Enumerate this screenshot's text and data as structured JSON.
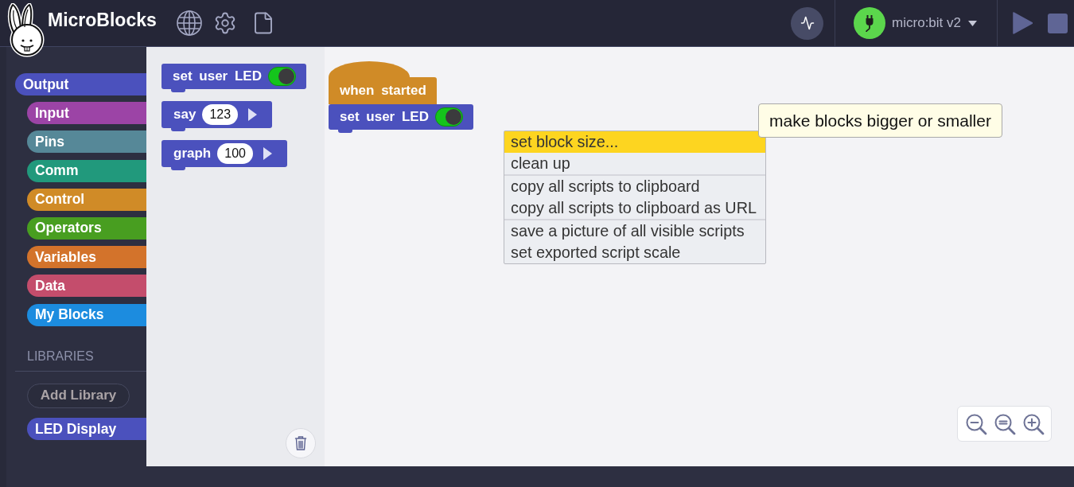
{
  "header": {
    "title": "MicroBlocks"
  },
  "board": {
    "name": "micro:bit v2",
    "connected": true
  },
  "categories": [
    {
      "label": "Output",
      "selected": true,
      "color": "#4b51bd"
    },
    {
      "label": "Input",
      "selected": false,
      "color": "#9c44a6"
    },
    {
      "label": "Pins",
      "selected": false,
      "color": "#568898"
    },
    {
      "label": "Comm",
      "selected": false,
      "color": "#21997c"
    },
    {
      "label": "Control",
      "selected": false,
      "color": "#d08b27"
    },
    {
      "label": "Operators",
      "selected": false,
      "color": "#489e20"
    },
    {
      "label": "Variables",
      "selected": false,
      "color": "#d3732b"
    },
    {
      "label": "Data",
      "selected": false,
      "color": "#c44d6c"
    },
    {
      "label": "My Blocks",
      "selected": false,
      "color": "#1c8cdf"
    }
  ],
  "libraries": {
    "heading": "LIBRARIES",
    "add_button": "Add Library",
    "items": [
      {
        "label": "LED Display",
        "selected": false,
        "color": "#4b51bd"
      }
    ]
  },
  "palette": {
    "blocks": [
      {
        "kind": "toggle",
        "label": "set user LED",
        "on": true
      },
      {
        "kind": "input",
        "label": "say",
        "value": "123"
      },
      {
        "kind": "input",
        "label": "graph",
        "value": "100"
      }
    ]
  },
  "scripts": [
    {
      "kind": "hat",
      "label": "when started"
    },
    {
      "kind": "toggle",
      "label": "set user LED",
      "on": true
    }
  ],
  "context_menu": {
    "groups": [
      [
        {
          "label": "set block size...",
          "selected": true
        },
        {
          "label": "clean up",
          "selected": false
        }
      ],
      [
        {
          "label": "copy all scripts to clipboard",
          "selected": false
        },
        {
          "label": "copy all scripts to clipboard as URL",
          "selected": false
        }
      ],
      [
        {
          "label": "save a picture of all visible scripts",
          "selected": false
        },
        {
          "label": "set exported script scale",
          "selected": false
        }
      ]
    ]
  },
  "tooltip": {
    "text": "make blocks bigger or smaller"
  }
}
